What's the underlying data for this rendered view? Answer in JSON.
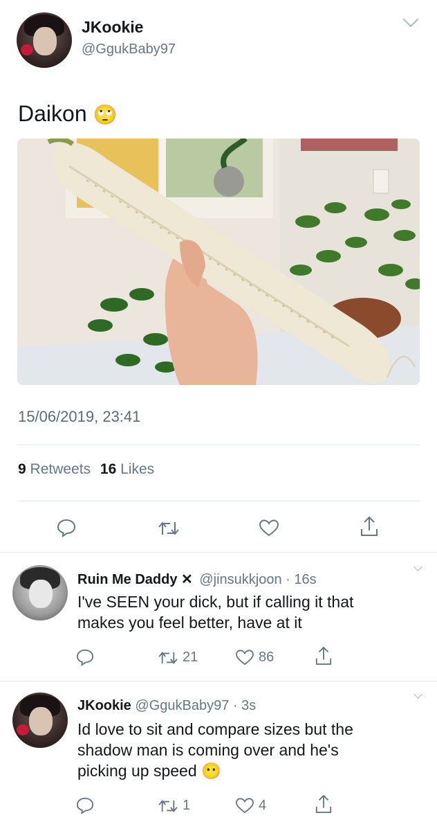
{
  "main_tweet": {
    "display_name": "JKookie",
    "handle": "@GgukBaby97",
    "text": "Daikon",
    "emoji": "🙄",
    "timestamp": "15/06/2019, 23:41",
    "retweets_count": "9",
    "retweets_label": "Retweets",
    "likes_count": "16",
    "likes_label": "Likes"
  },
  "replies": [
    {
      "display_name": "Ruin Me Daddy",
      "badge": "✕",
      "handle": "@jinsukkjoon",
      "time": "16s",
      "text_line1": "I've SEEN your dick, but if calling it that",
      "text_line2": "makes you feel better, have at it",
      "retweets": "21",
      "likes": "86"
    },
    {
      "display_name": "JKookie",
      "handle": "@GgukBaby97",
      "time": "3s",
      "text_line1": "Id love to sit and compare sizes but the",
      "text_line2": "shadow man is coming over and he's",
      "text_line3": "picking up speed",
      "emoji": "😶",
      "retweets": "1",
      "likes": "4"
    }
  ],
  "icons": [
    "reply-icon",
    "retweet-icon",
    "like-icon",
    "share-icon",
    "chevron-down-icon"
  ],
  "colors": {
    "text": "#14171a",
    "muted": "#657786",
    "divider": "#e1e8ed"
  }
}
